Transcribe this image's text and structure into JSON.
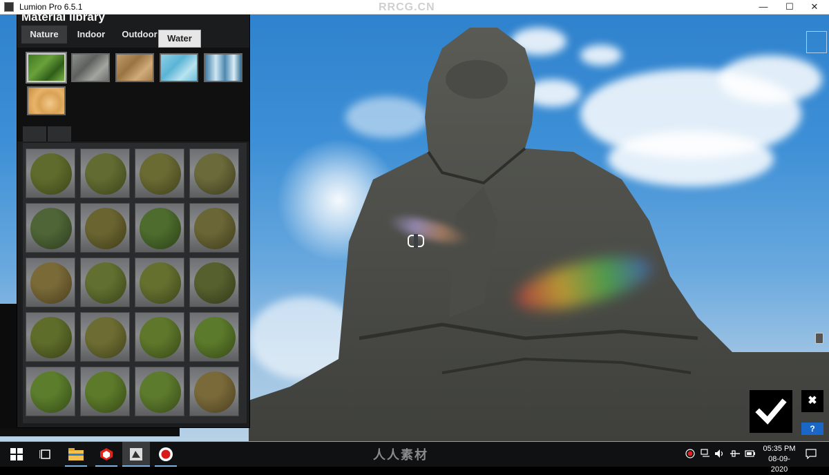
{
  "window": {
    "title": "Lumion Pro 6.5.1",
    "watermark": "RRCG.CN",
    "minimize": "—",
    "maximize": "☐",
    "close": "✕"
  },
  "material_library": {
    "title": "Material library",
    "tabs": [
      {
        "label": "Nature",
        "active": true
      },
      {
        "label": "Indoor",
        "active": false
      },
      {
        "label": "Outdoor",
        "active": false
      },
      {
        "label": "Water",
        "active": false
      }
    ],
    "categories": [
      {
        "icon": "grass-swatch",
        "selected": true
      },
      {
        "icon": "rock-swatch",
        "selected": false
      },
      {
        "icon": "soil-swatch",
        "selected": false
      },
      {
        "icon": "water-swatch",
        "selected": false
      },
      {
        "icon": "waterfall-swatch",
        "selected": false
      },
      {
        "icon": "wood-swatch",
        "selected": false
      }
    ],
    "subtab_count": 2,
    "grid_rows": 5,
    "grid_cols": 4
  },
  "actions": {
    "confirm_icon": "checkmark-icon",
    "close_label": "✖",
    "help_label": "?"
  },
  "taskbar": {
    "center_watermark": "人人素材",
    "time": "05:35 PM",
    "date": "08-09-2020"
  }
}
